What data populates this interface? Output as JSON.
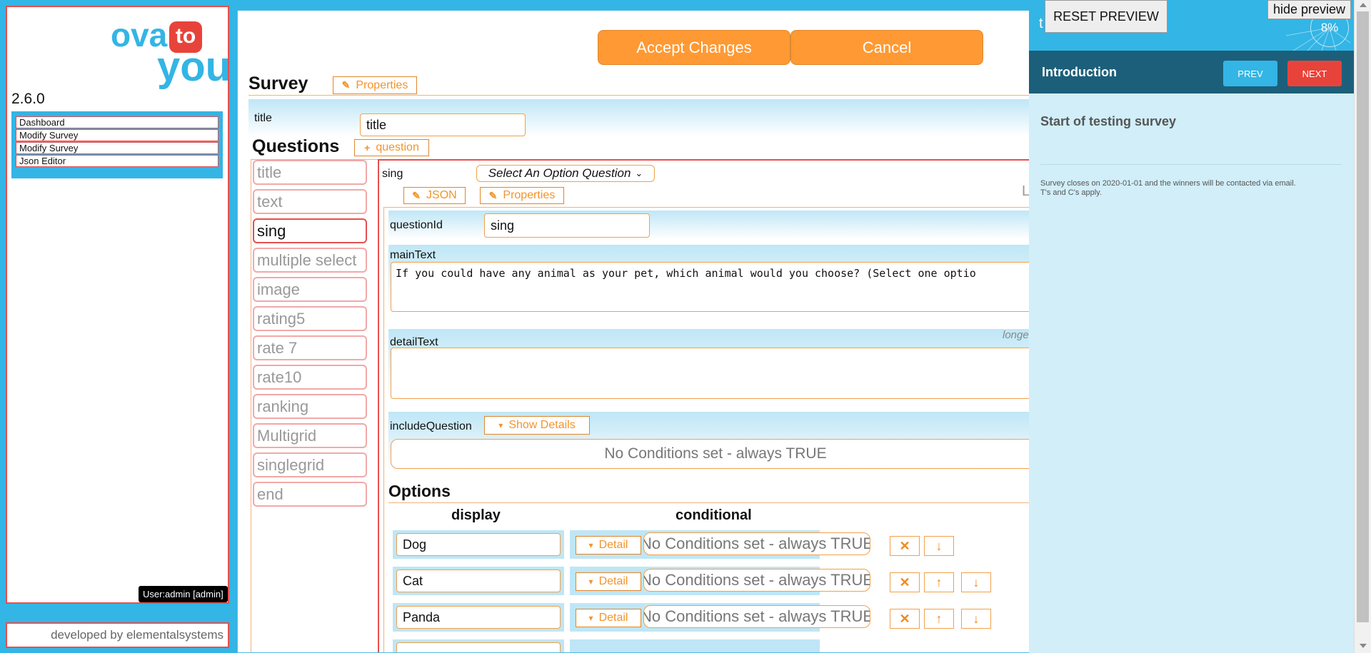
{
  "sidebar": {
    "logo": {
      "word1": "ova",
      "word2": "to",
      "word3": "you"
    },
    "version": "2.6.0",
    "nav": [
      "Dashboard",
      "Modify Survey",
      "Modify Survey",
      "Json Editor"
    ],
    "user": "User:admin [admin]",
    "footer": "developed by elementalsystems"
  },
  "toolbar": {
    "accept": "Accept Changes",
    "cancel": "Cancel"
  },
  "survey": {
    "heading": "Survey",
    "properties": "Properties",
    "title_label": "title",
    "title_value": "title"
  },
  "questions": {
    "heading": "Questions",
    "add": "question",
    "items": [
      "title",
      "text",
      "sing",
      "multiple select",
      "image",
      "rating5",
      "rate 7",
      "rate10",
      "ranking",
      "Multigrid",
      "singlegrid",
      "end"
    ]
  },
  "question_editor": {
    "name": "sing",
    "type": "Select An Option Question",
    "json": "JSON",
    "properties": "Properties",
    "clipped_right": "L",
    "questionId_label": "questionId",
    "questionId_value": "sing",
    "mainText_label": "mainText",
    "mainText_value": "If you could have any animal as your pet, which animal would you choose? (Select one optio",
    "detailText_label": "detailText",
    "detail_hint": "longe",
    "include_label": "includeQuestion",
    "show_details": "Show Details",
    "no_conditions": "No Conditions set - always TRUE"
  },
  "options": {
    "heading": "Options",
    "col_display": "display",
    "col_conditional": "conditional",
    "detail": "Detail",
    "rows": [
      "Dog",
      "Cat",
      "Panda"
    ]
  },
  "preview": {
    "reset": "RESET PREVIEW",
    "hide": "hide preview",
    "clipped_title": "t",
    "progress": "8%",
    "section": "Introduction",
    "prev": "PREV",
    "next": "NEXT",
    "intro": "Start of testing survey",
    "note_line1": "Survey closes on 2020-01-01 and the winners will be contacted via email.",
    "note_line2": "T's and C's apply."
  }
}
